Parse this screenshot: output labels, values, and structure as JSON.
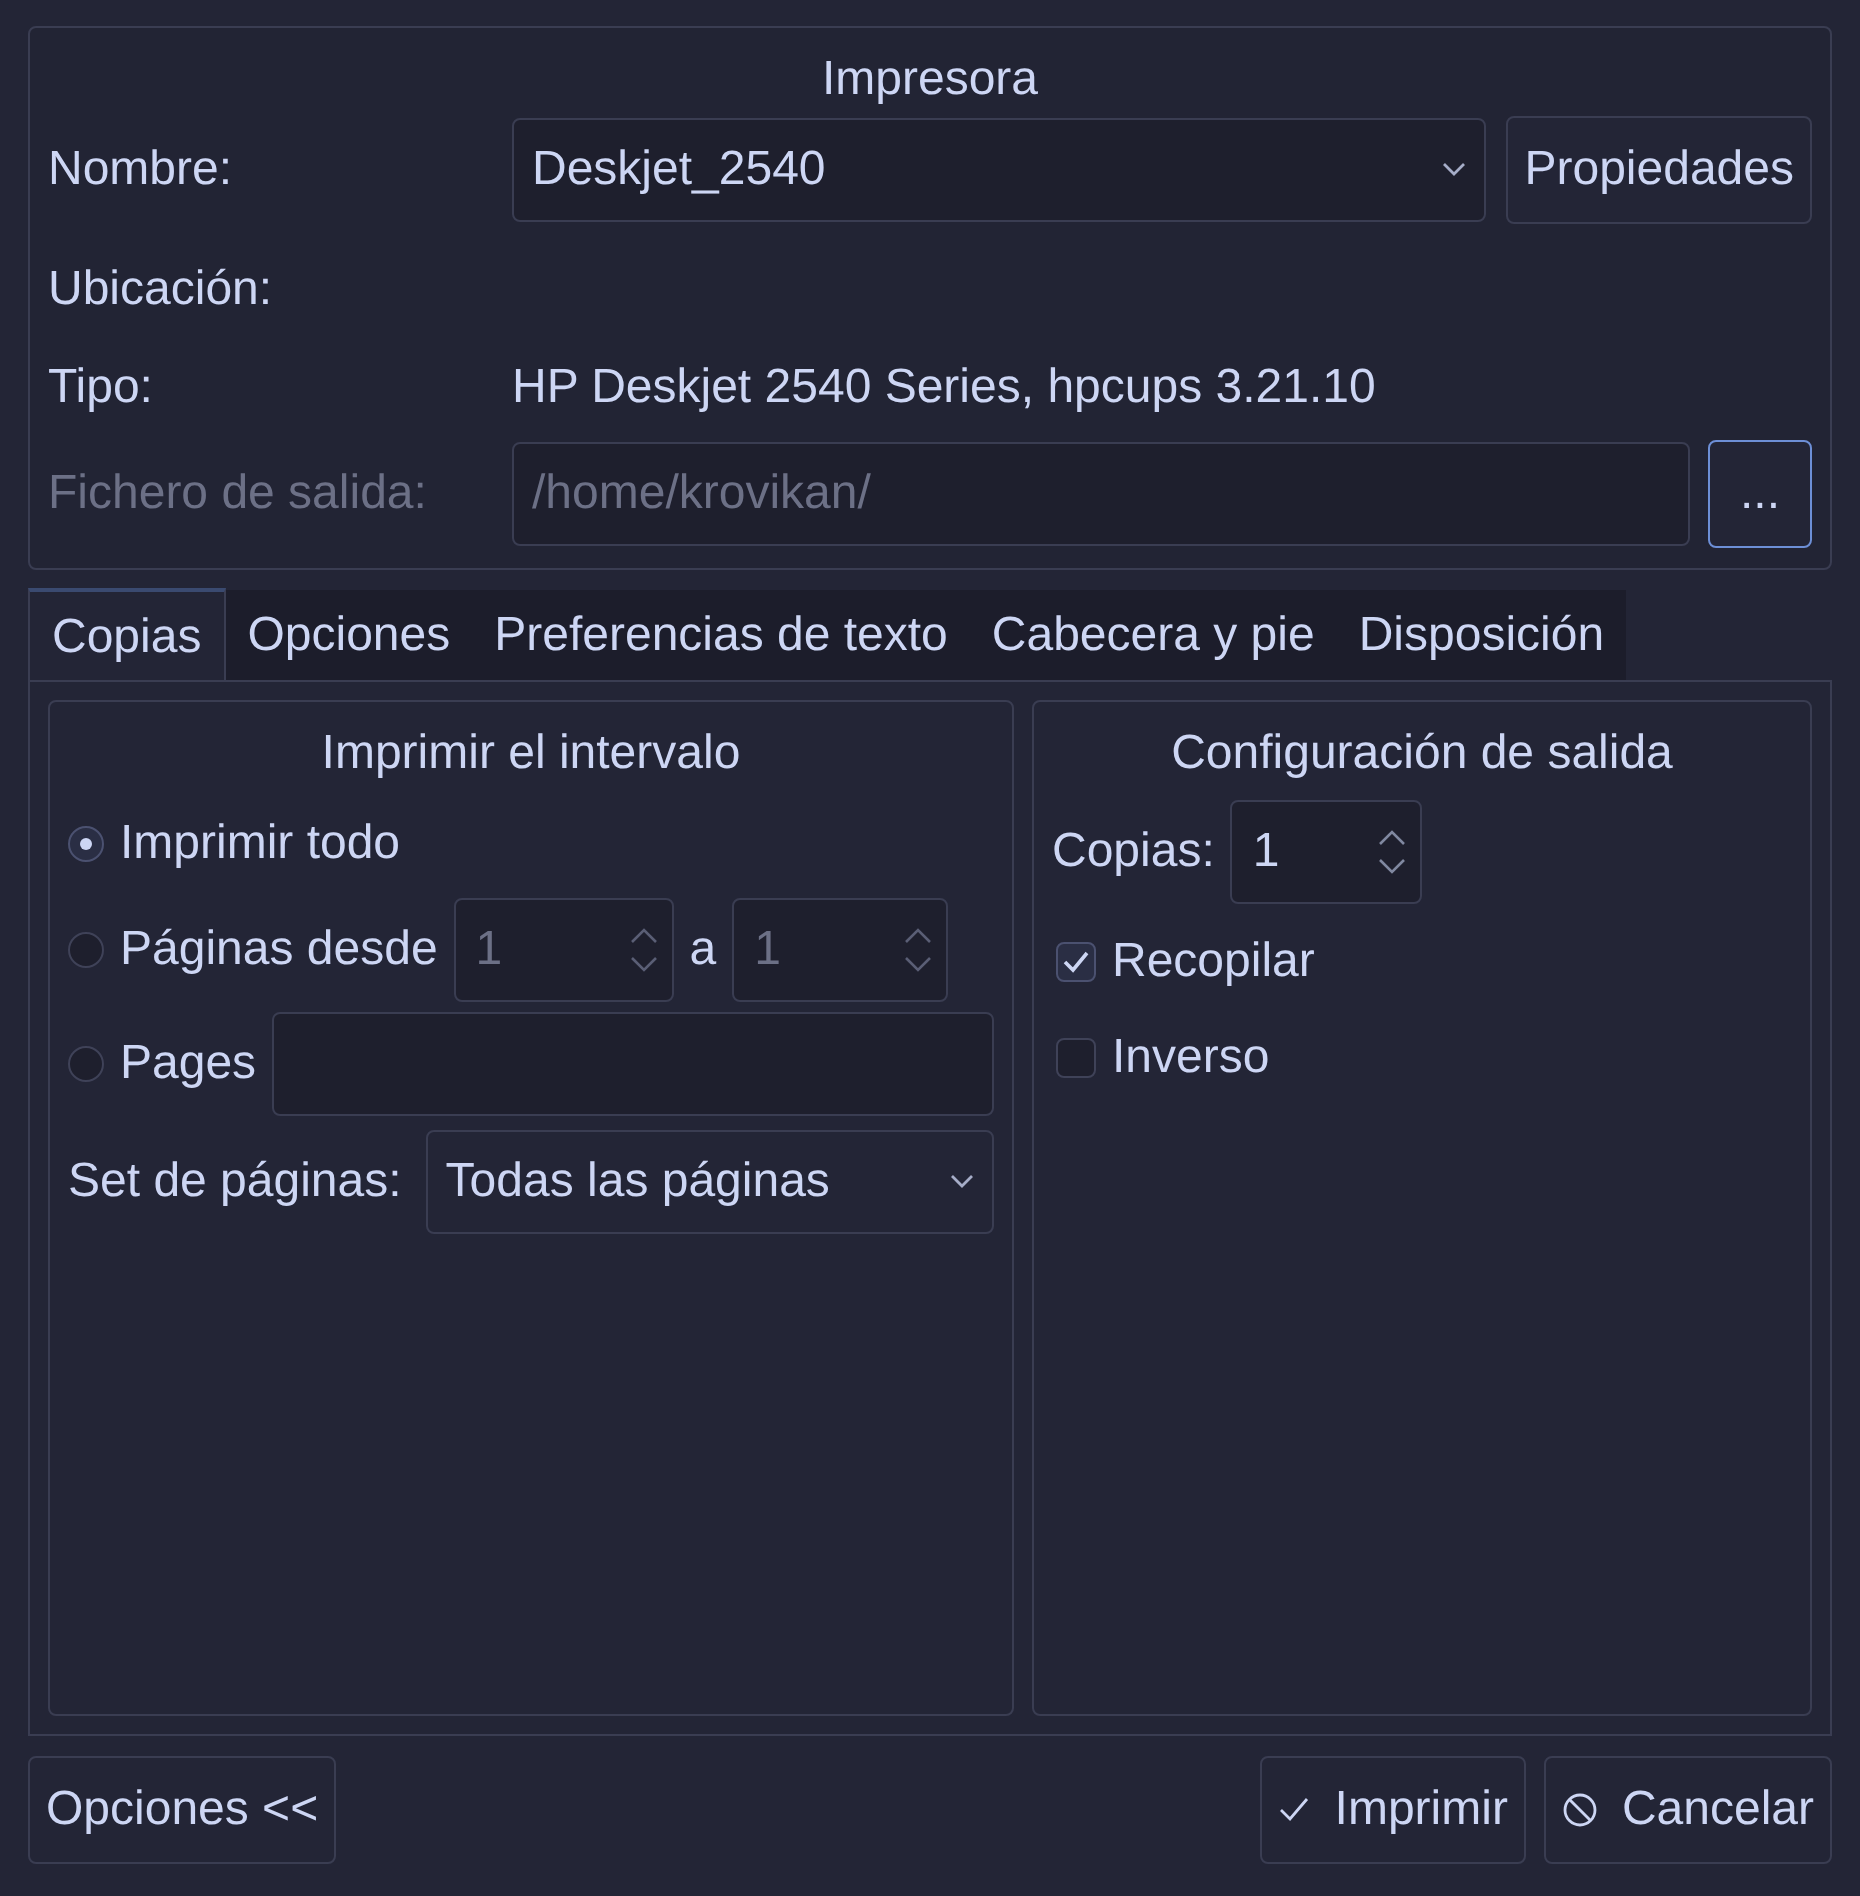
{
  "printer": {
    "title": "Impresora",
    "name": {
      "label": "Nombre:",
      "value": "Deskjet_2540"
    },
    "properties_button": "Propiedades",
    "location": {
      "label": "Ubicación:"
    },
    "type": {
      "label": "Tipo:",
      "value": "HP Deskjet 2540 Series, hpcups 3.21.10"
    },
    "output_file": {
      "label": "Fichero de salida:",
      "value": "/home/krovikan/",
      "disabled": true
    },
    "browse_button": "..."
  },
  "tabs": [
    {
      "label": "Copias",
      "selected": true
    },
    {
      "label": "Opciones",
      "selected": false
    },
    {
      "label": "Preferencias de texto",
      "selected": false
    },
    {
      "label": "Cabecera y pie",
      "selected": false
    },
    {
      "label": "Disposición",
      "selected": false
    }
  ],
  "print_range": {
    "title": "Imprimir el intervalo",
    "options": [
      {
        "kind": "plain",
        "label": "Imprimir todo",
        "selected": true
      },
      {
        "kind": "range",
        "label": "Páginas desde",
        "from": "1",
        "separator": "a",
        "to": "1",
        "selected": false
      },
      {
        "kind": "text",
        "label": "Pages",
        "selected": false
      }
    ],
    "page_set": {
      "label": "Set de páginas:",
      "value": "Todas las páginas"
    }
  },
  "output": {
    "title": "Configuración de salida",
    "copies": {
      "label": "Copias:",
      "value": "1"
    },
    "checkboxes": [
      {
        "label": "Recopilar",
        "checked": true
      },
      {
        "label": "Inverso",
        "checked": false
      }
    ]
  },
  "buttons": [
    {
      "kind": "options",
      "label": "Opciones <<"
    },
    {
      "kind": "print",
      "label": "Imprimir"
    },
    {
      "kind": "cancel",
      "label": "Cancelar"
    }
  ]
}
